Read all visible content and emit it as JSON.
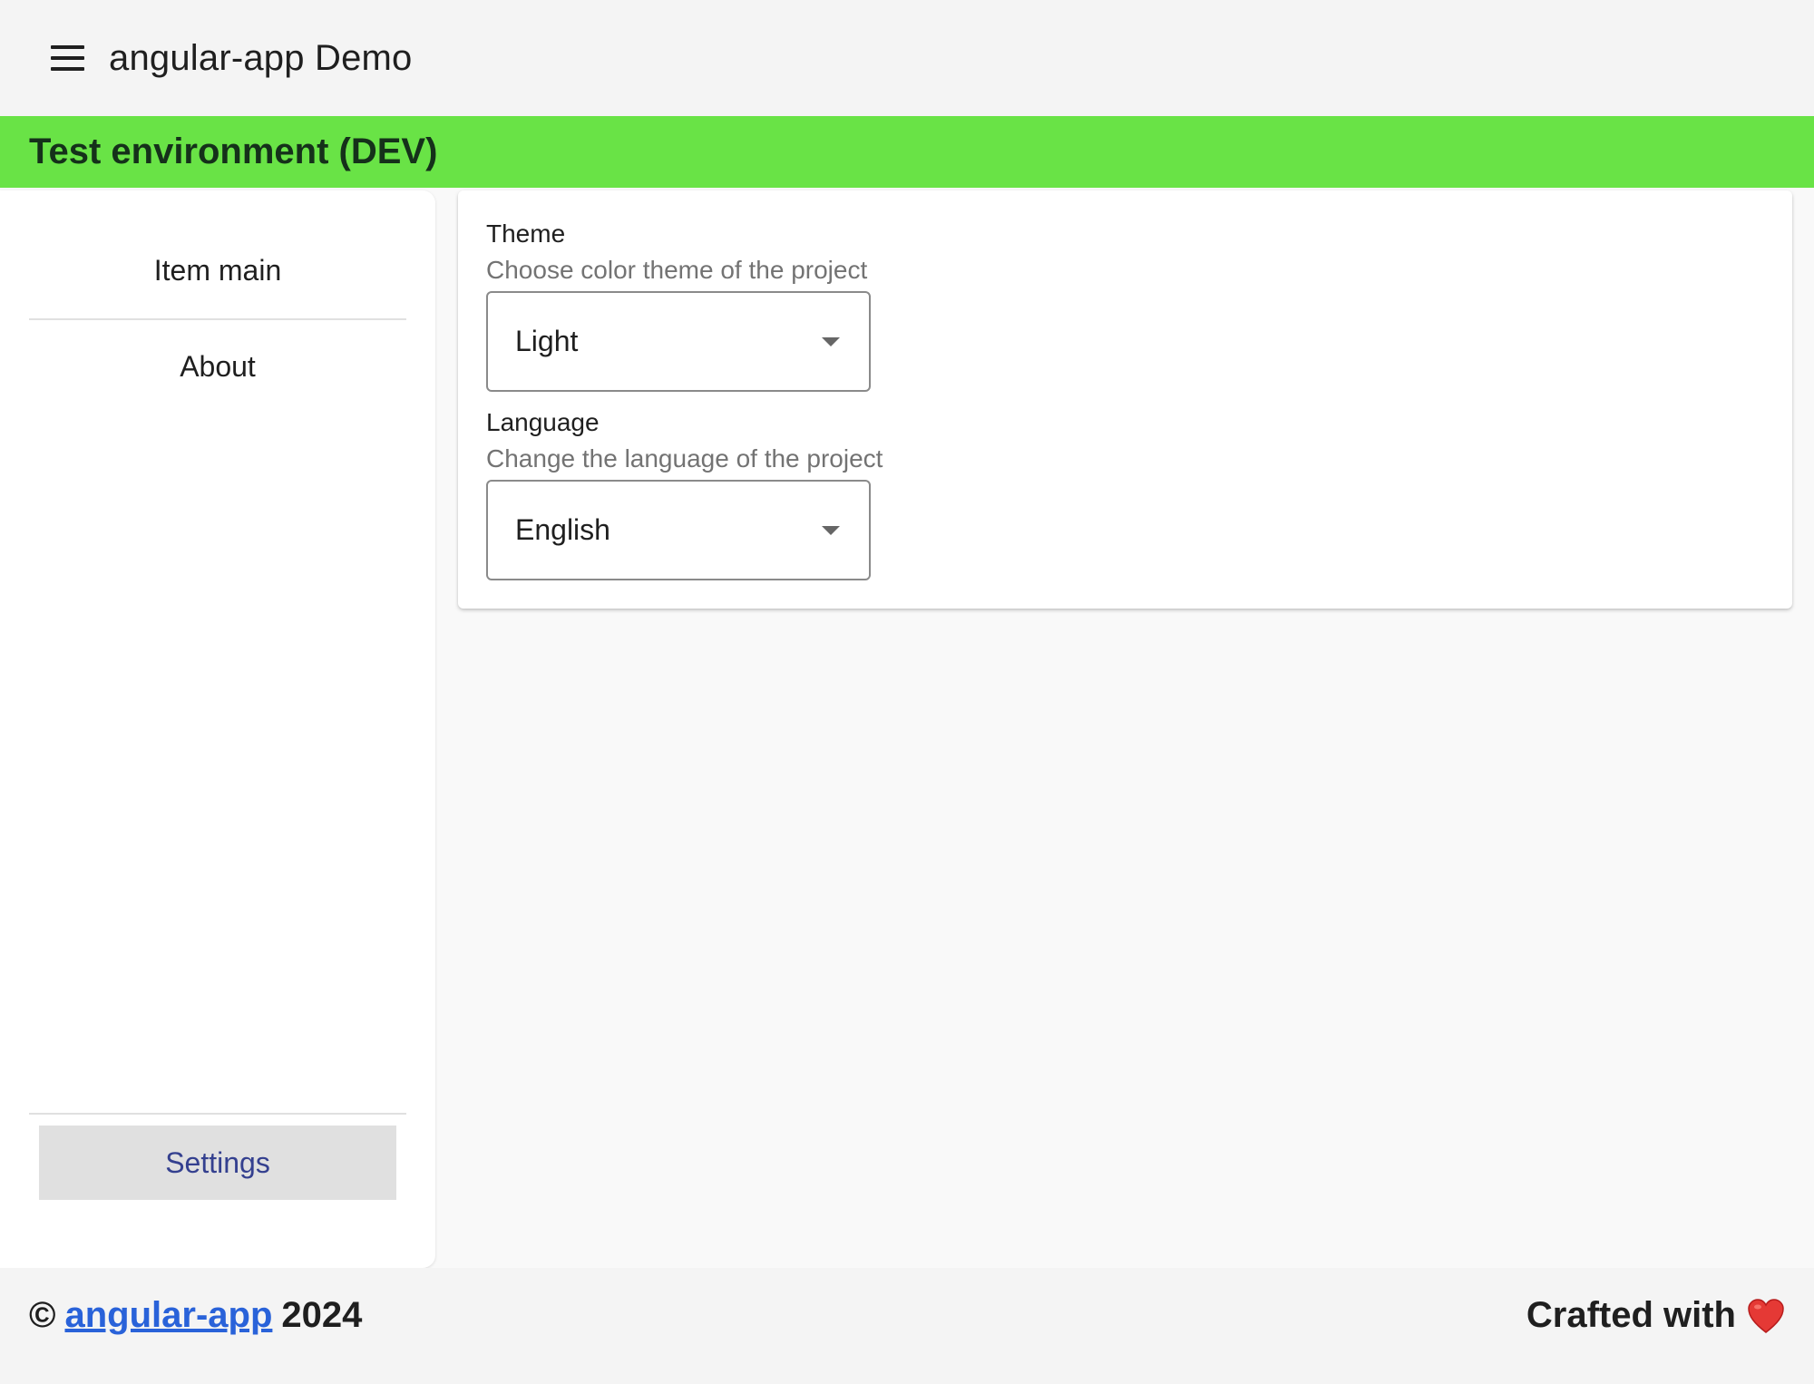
{
  "header": {
    "title": "angular-app Demo",
    "menu_icon": "menu-icon"
  },
  "env_banner": {
    "text": "Test environment (DEV)",
    "color": "#69e346"
  },
  "sidenav": {
    "items": [
      {
        "label": "Item main"
      },
      {
        "label": "About"
      }
    ],
    "settings_label": "Settings"
  },
  "settings": {
    "theme": {
      "label": "Theme",
      "hint": "Choose color theme of the project",
      "value": "Light"
    },
    "language": {
      "label": "Language",
      "hint": "Change the language of the project",
      "value": "English"
    }
  },
  "footer": {
    "copyright_symbol": "©",
    "link_text": "angular-app",
    "year": "2024",
    "crafted_text": "Crafted with",
    "heart_icon": "heart-icon",
    "link_color": "#2962d9"
  }
}
